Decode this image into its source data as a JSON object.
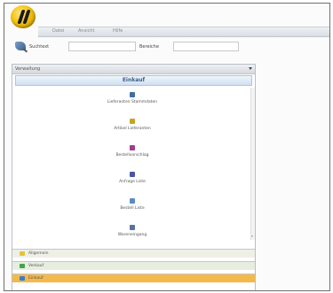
{
  "menubar": {
    "items": [
      "Datei",
      "Ansicht",
      "Hilfe"
    ]
  },
  "toolbar": {
    "search_label": "Suchtext",
    "filter_label": "Bereiche"
  },
  "panel": {
    "header": "Verwaltung",
    "section_title": "Einkauf",
    "items": [
      {
        "label": "Lieferanten Stammdaten",
        "icon": "supplier-icon",
        "color": "#3e6fa8"
      },
      {
        "label": "Artikel Lieferanten",
        "icon": "article-icon",
        "color": "#c9a227"
      },
      {
        "label": "Bestellvorschlag",
        "icon": "proposal-icon",
        "color": "#a33d8c"
      },
      {
        "label": "Anfrage Liste",
        "icon": "inquiry-icon",
        "color": "#4a55a8"
      },
      {
        "label": "Bestell Liste",
        "icon": "order-icon",
        "color": "#5b8ac4"
      },
      {
        "label": "Wareneingang",
        "icon": "goods-receipt-icon",
        "color": "#5b6fa0"
      }
    ]
  },
  "nav": [
    {
      "label": "Allgemein",
      "icon": "folder-icon",
      "color": "#e6c23a",
      "bg": "#eef0e6"
    },
    {
      "label": "Verkauf",
      "icon": "sales-icon",
      "color": "#3ea64a",
      "bg": "#e7eddf"
    },
    {
      "label": "Einkauf",
      "icon": "purchase-icon",
      "color": "#3a7fc4",
      "bg": "#f4b94a"
    }
  ],
  "colors": {
    "active_nav": "#f4b94a",
    "section_text": "#3c5f86"
  }
}
